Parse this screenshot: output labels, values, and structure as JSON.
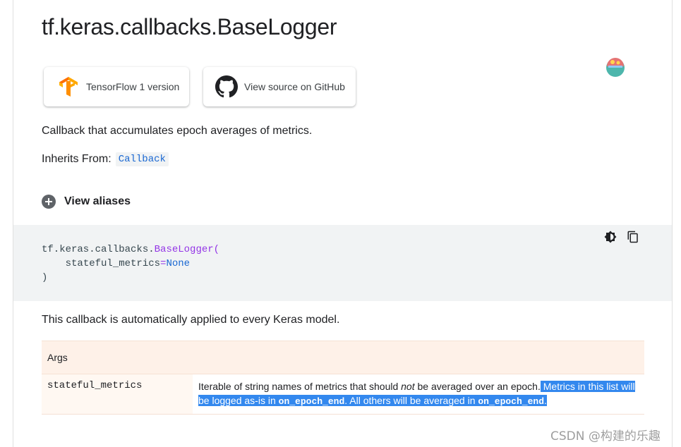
{
  "page": {
    "title": "tf.keras.callbacks.BaseLogger",
    "buttons": {
      "tf1_label": "TensorFlow 1 version",
      "github_label": "View source on GitHub"
    },
    "description": "Callback that accumulates epoch averages of metrics.",
    "inherits_label": "Inherits From:",
    "inherits_value": "Callback",
    "aliases_label": "View aliases"
  },
  "code": {
    "prefix": "tf.keras.callbacks.",
    "func": "BaseLogger",
    "open_paren": "(",
    "indent": "    ",
    "param": "stateful_metrics",
    "equals": "=",
    "value": "None",
    "close_paren": ")",
    "icons": [
      "theme-toggle-icon",
      "copy-icon"
    ]
  },
  "auto_text": "This callback is automatically applied to every Keras model.",
  "args": {
    "header": "Args",
    "rows": [
      {
        "name": "stateful_metrics",
        "desc_plain_1": "Iterable of string names of metrics that should ",
        "desc_em": "not",
        "desc_plain_2": " be averaged over an epoch.",
        "desc_sel_1": " Metrics in this list will be logged as-is in ",
        "desc_code_1": "on_epoch_end",
        "desc_sel_2": ". All others will be averaged in ",
        "desc_code_2": "on_epoch_end",
        "desc_sel_3": "."
      }
    ]
  },
  "watermark": "CSDN @构建的乐趣",
  "colors": {
    "link_code": "#1967d2",
    "func_purple": "#9334e6",
    "tf_orange": "#ff8f00",
    "selection": "#3388ee",
    "table_header_bg": "#fef1e8"
  }
}
